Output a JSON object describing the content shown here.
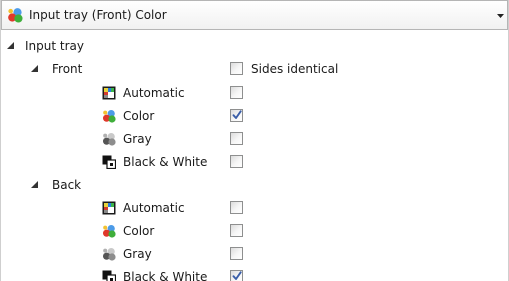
{
  "combo": {
    "selected": "Input tray (Front) Color",
    "icon": "color-photo-icon"
  },
  "tree": {
    "root_label": "Input tray",
    "front": {
      "label": "Front",
      "sides_identical_label": "Sides identical",
      "sides_identical_checked": false,
      "options": [
        {
          "label": "Automatic",
          "icon": "automatic-mode-icon",
          "checked": false
        },
        {
          "label": "Color",
          "icon": "color-photo-icon",
          "checked": true
        },
        {
          "label": "Gray",
          "icon": "gray-photo-icon",
          "checked": false
        },
        {
          "label": "Black & White",
          "icon": "black-white-icon",
          "checked": false
        }
      ]
    },
    "back": {
      "label": "Back",
      "options": [
        {
          "label": "Automatic",
          "icon": "automatic-mode-icon",
          "checked": false
        },
        {
          "label": "Color",
          "icon": "color-photo-icon",
          "checked": false
        },
        {
          "label": "Gray",
          "icon": "gray-photo-icon",
          "checked": false
        },
        {
          "label": "Black & White",
          "icon": "black-white-icon",
          "checked": true
        }
      ]
    }
  },
  "colors": {
    "checkmark": "#3a5ea8",
    "checkbox_border": "#8e8f8f",
    "expander": "#333333"
  }
}
